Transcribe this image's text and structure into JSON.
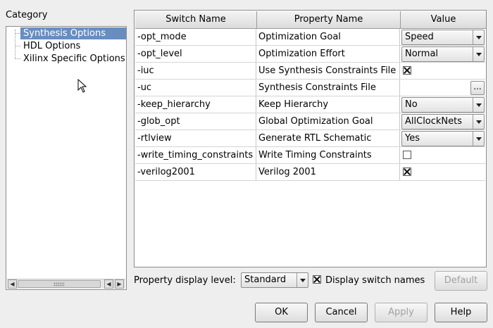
{
  "category": {
    "label": "Category",
    "items": [
      {
        "label": "Synthesis Options",
        "selected": true
      },
      {
        "label": "HDL Options",
        "selected": false
      },
      {
        "label": "Xilinx Specific Options",
        "selected": false
      }
    ]
  },
  "table": {
    "columns": [
      "Switch Name",
      "Property Name",
      "Value"
    ],
    "rows": [
      {
        "switch": "-opt_mode",
        "property": "Optimization Goal",
        "type": "combo",
        "value": "Speed"
      },
      {
        "switch": "-opt_level",
        "property": "Optimization Effort",
        "type": "combo",
        "value": "Normal"
      },
      {
        "switch": "-iuc",
        "property": "Use Synthesis Constraints File",
        "type": "checkbox",
        "checked": true
      },
      {
        "switch": "-uc",
        "property": "Synthesis Constraints File",
        "type": "file",
        "button": "..."
      },
      {
        "switch": "-keep_hierarchy",
        "property": "Keep Hierarchy",
        "type": "combo",
        "value": "No"
      },
      {
        "switch": "-glob_opt",
        "property": "Global Optimization Goal",
        "type": "combo",
        "value": "AllClockNets"
      },
      {
        "switch": "-rtlview",
        "property": "Generate RTL Schematic",
        "type": "combo",
        "value": "Yes"
      },
      {
        "switch": "-write_timing_constraints",
        "property": "Write Timing Constraints",
        "type": "checkbox",
        "checked": false
      },
      {
        "switch": "-verilog2001",
        "property": "Verilog 2001",
        "type": "checkbox",
        "checked": true
      }
    ]
  },
  "bottom": {
    "property_display_level_label": "Property display level:",
    "property_display_level_value": "Standard",
    "display_switch_names_label": "Display switch names",
    "display_switch_names_checked": true,
    "default_label": "Default"
  },
  "buttons": {
    "ok": "OK",
    "cancel": "Cancel",
    "apply": "Apply",
    "help": "Help"
  },
  "colors": {
    "selection": "#6a8dc0",
    "background": "#eeeeee"
  }
}
